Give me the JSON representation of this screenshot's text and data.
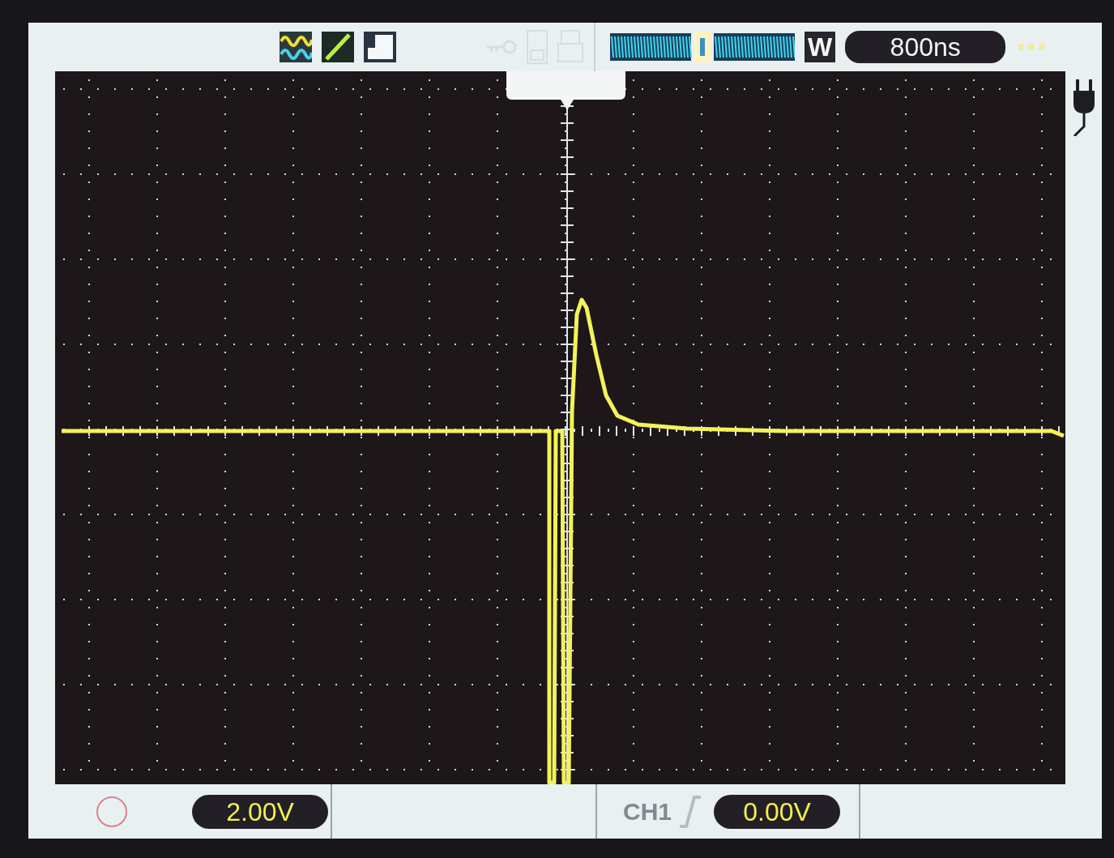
{
  "header": {
    "mode_badge": "W",
    "timebase": "800ns"
  },
  "footer": {
    "channel_scale": "2.00V",
    "trigger_source": "CH1",
    "trigger_level": "0.00V"
  }
}
